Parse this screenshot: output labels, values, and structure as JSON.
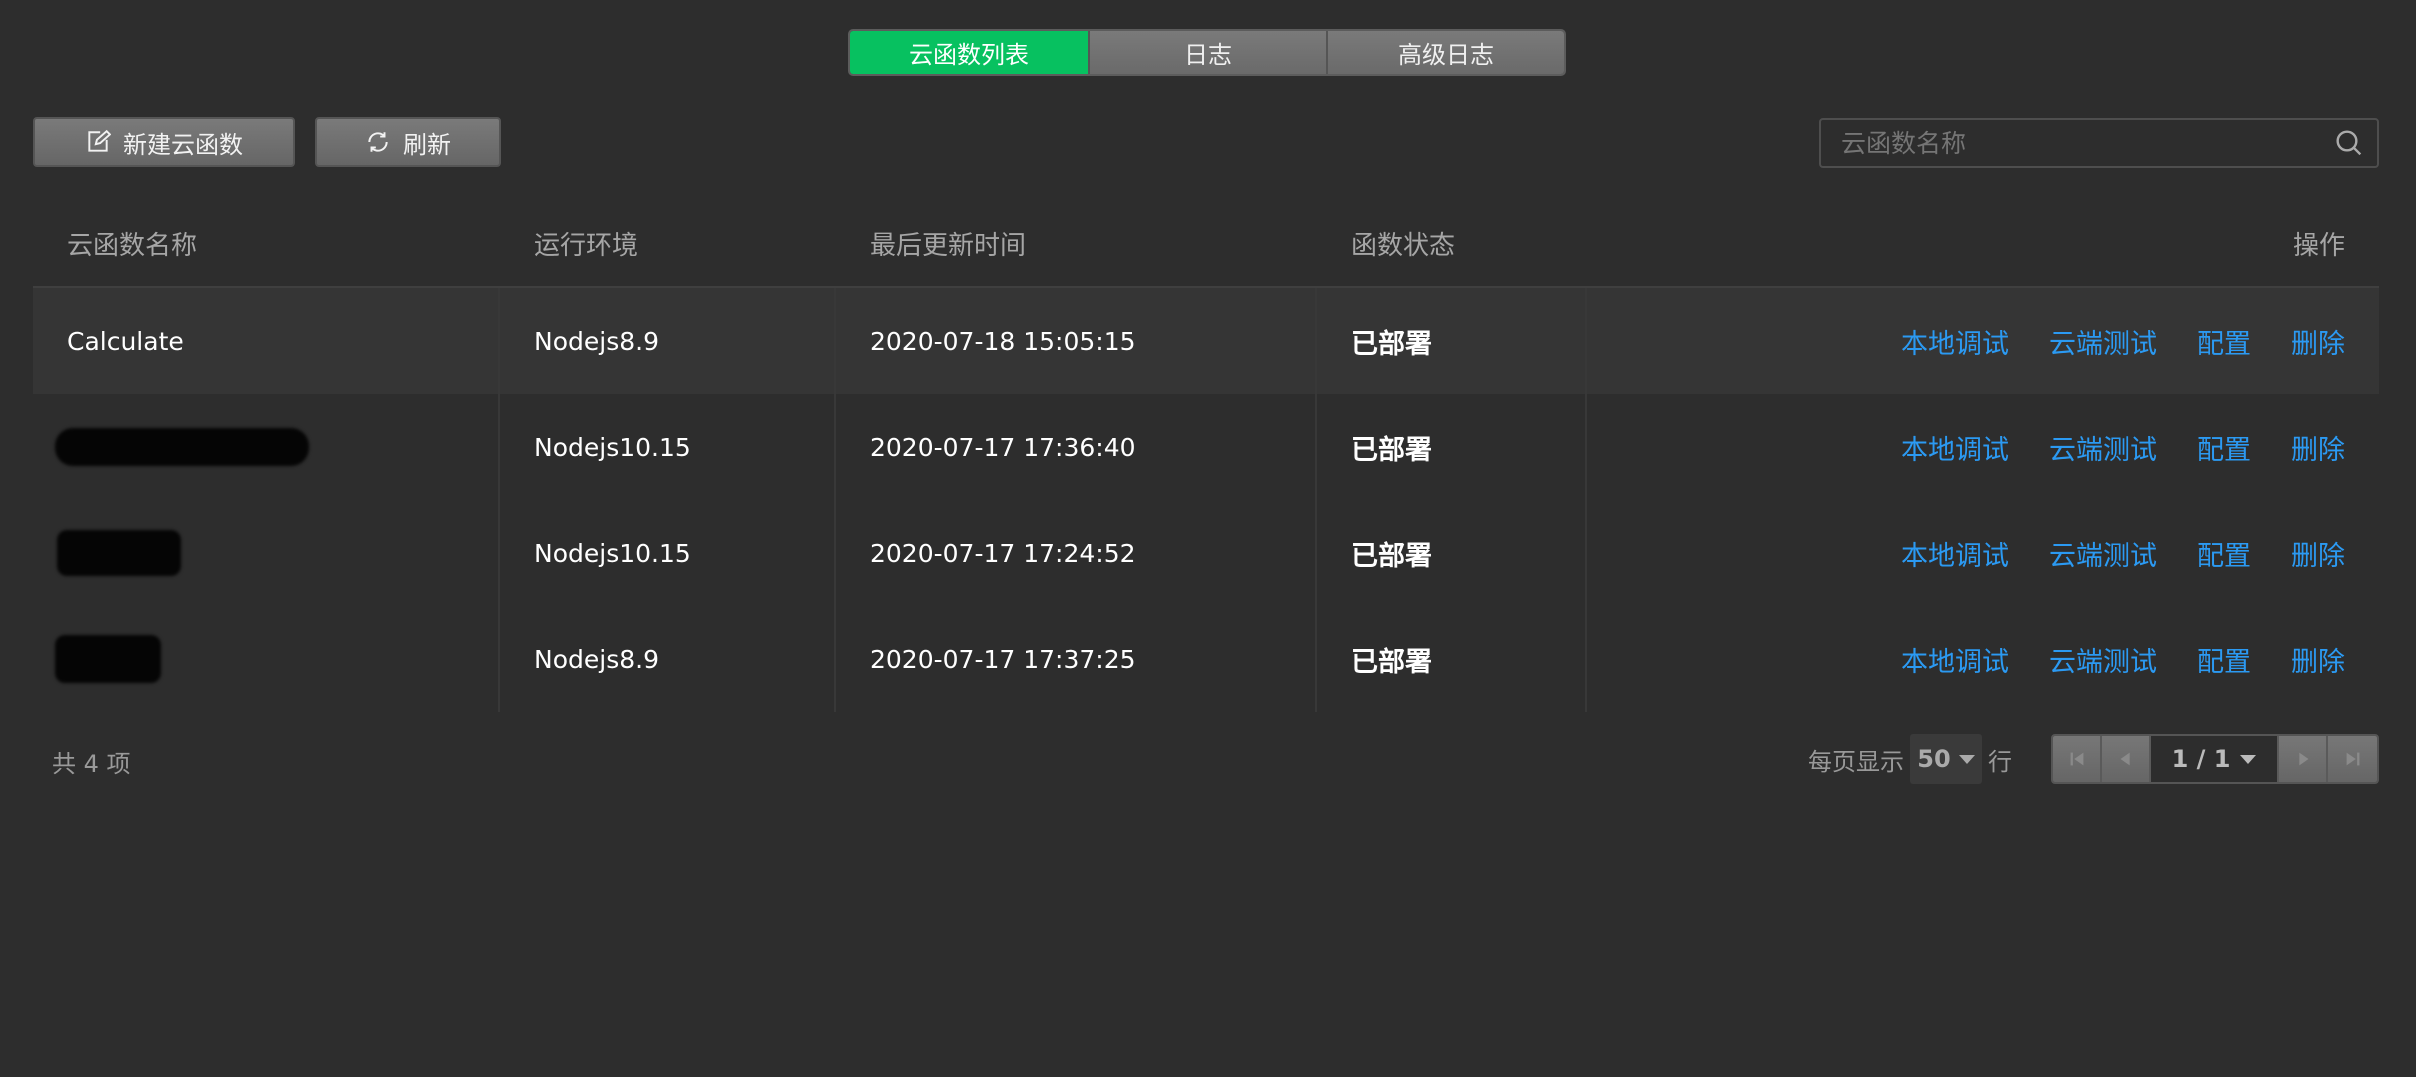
{
  "tabs": [
    {
      "label": "云函数列表",
      "active": true
    },
    {
      "label": "日志",
      "active": false
    },
    {
      "label": "高级日志",
      "active": false
    }
  ],
  "toolbar": {
    "new_label": "新建云函数",
    "new_icon": "edit-icon",
    "refresh_label": "刷新",
    "refresh_icon": "refresh-icon"
  },
  "search": {
    "placeholder": "云函数名称",
    "value": "",
    "icon": "search-icon"
  },
  "table": {
    "headers": {
      "name": "云函数名称",
      "runtime": "运行环境",
      "updated": "最后更新时间",
      "status": "函数状态",
      "actions": "操作"
    },
    "rows": [
      {
        "name": "Calculate",
        "runtime": "Nodejs8.9",
        "updated": "2020-07-18 15:05:15",
        "status": "已部署"
      },
      {
        "name": "",
        "runtime": "Nodejs10.15",
        "updated": "2020-07-17 17:36:40",
        "status": "已部署"
      },
      {
        "name": "",
        "runtime": "Nodejs10.15",
        "updated": "2020-07-17 17:24:52",
        "status": "已部署"
      },
      {
        "name": "",
        "runtime": "Nodejs8.9",
        "updated": "2020-07-17 17:37:25",
        "status": "已部署"
      }
    ],
    "actions": {
      "local_debug": "本地调试",
      "cloud_test": "云端测试",
      "config": "配置",
      "delete": "删除"
    }
  },
  "footer": {
    "total": "共 4 项",
    "per_page_label": "每页显示",
    "per_page_value": "50",
    "per_page_unit": "行",
    "page_indicator": "1 / 1"
  },
  "colors": {
    "accent": "#07c160",
    "link": "#2b9af3",
    "background": "#2d2d2d"
  }
}
